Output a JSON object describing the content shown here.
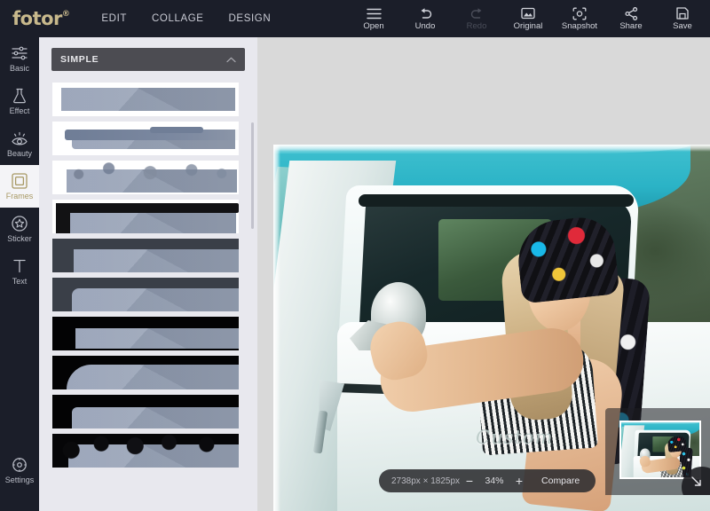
{
  "app": {
    "brand": "fotor",
    "brand_mark": "®"
  },
  "topnav": {
    "items": [
      {
        "label": "EDIT",
        "name": "nav-edit"
      },
      {
        "label": "COLLAGE",
        "name": "nav-collage"
      },
      {
        "label": "DESIGN",
        "name": "nav-design"
      }
    ]
  },
  "toolbar": {
    "tools": [
      {
        "label": "Open",
        "icon": "menu-icon",
        "disabled": false
      },
      {
        "label": "Undo",
        "icon": "undo-icon",
        "disabled": false
      },
      {
        "label": "Redo",
        "icon": "redo-icon",
        "disabled": true
      },
      {
        "label": "Original",
        "icon": "image-icon",
        "disabled": false
      },
      {
        "label": "Snapshot",
        "icon": "camera-icon",
        "disabled": false
      },
      {
        "label": "Share",
        "icon": "share-icon",
        "disabled": false
      },
      {
        "label": "Save",
        "icon": "save-icon",
        "disabled": false
      }
    ]
  },
  "sidebar": {
    "items": [
      {
        "label": "Basic",
        "icon": "sliders-icon",
        "active": false
      },
      {
        "label": "Effect",
        "icon": "flask-icon",
        "active": false
      },
      {
        "label": "Beauty",
        "icon": "eye-icon",
        "active": false
      },
      {
        "label": "Frames",
        "icon": "frame-icon",
        "active": true
      },
      {
        "label": "Sticker",
        "icon": "star-icon",
        "active": false
      },
      {
        "label": "Text",
        "icon": "text-icon",
        "active": false
      }
    ],
    "settings": {
      "label": "Settings",
      "icon": "gear-icon"
    }
  },
  "panel": {
    "section_title": "SIMPLE",
    "collapse_icon": "chevron-up-icon",
    "frames": [
      {
        "name": "frame-thin-line",
        "style": "thin-line"
      },
      {
        "name": "frame-brush-stroke",
        "style": "brush"
      },
      {
        "name": "frame-splatter",
        "style": "splatter"
      },
      {
        "name": "frame-ink-bar",
        "style": "ink-bar"
      },
      {
        "name": "frame-dark-corner",
        "style": "dark-corner"
      },
      {
        "name": "frame-dark-round",
        "style": "dark-round"
      },
      {
        "name": "frame-black-corner",
        "style": "black-corner"
      },
      {
        "name": "frame-black-curve",
        "style": "black-curve"
      },
      {
        "name": "frame-black-block",
        "style": "black-block"
      },
      {
        "name": "frame-grunge",
        "style": "grunge"
      }
    ]
  },
  "canvas": {
    "zoombar": {
      "dimensions": "2738px × 1825px",
      "zoom_out_label": "−",
      "zoom_value": "34%",
      "zoom_in_label": "+",
      "compare_label": "Compare"
    },
    "photo": {
      "alt_name": "woman-in-vintage-truck",
      "door_script": "Custom"
    },
    "minimap": {
      "name": "navigator-minimap",
      "collapse_icon": "arrow-down-right-icon"
    }
  },
  "colors": {
    "top_bar": "#1b1e29",
    "brand": "#c8b98c",
    "accent_active": "#a79863",
    "panel_bg": "#e8e8ee",
    "canvas_bg": "#d9d9d9",
    "panel_header_bg": "#4c4c52"
  }
}
